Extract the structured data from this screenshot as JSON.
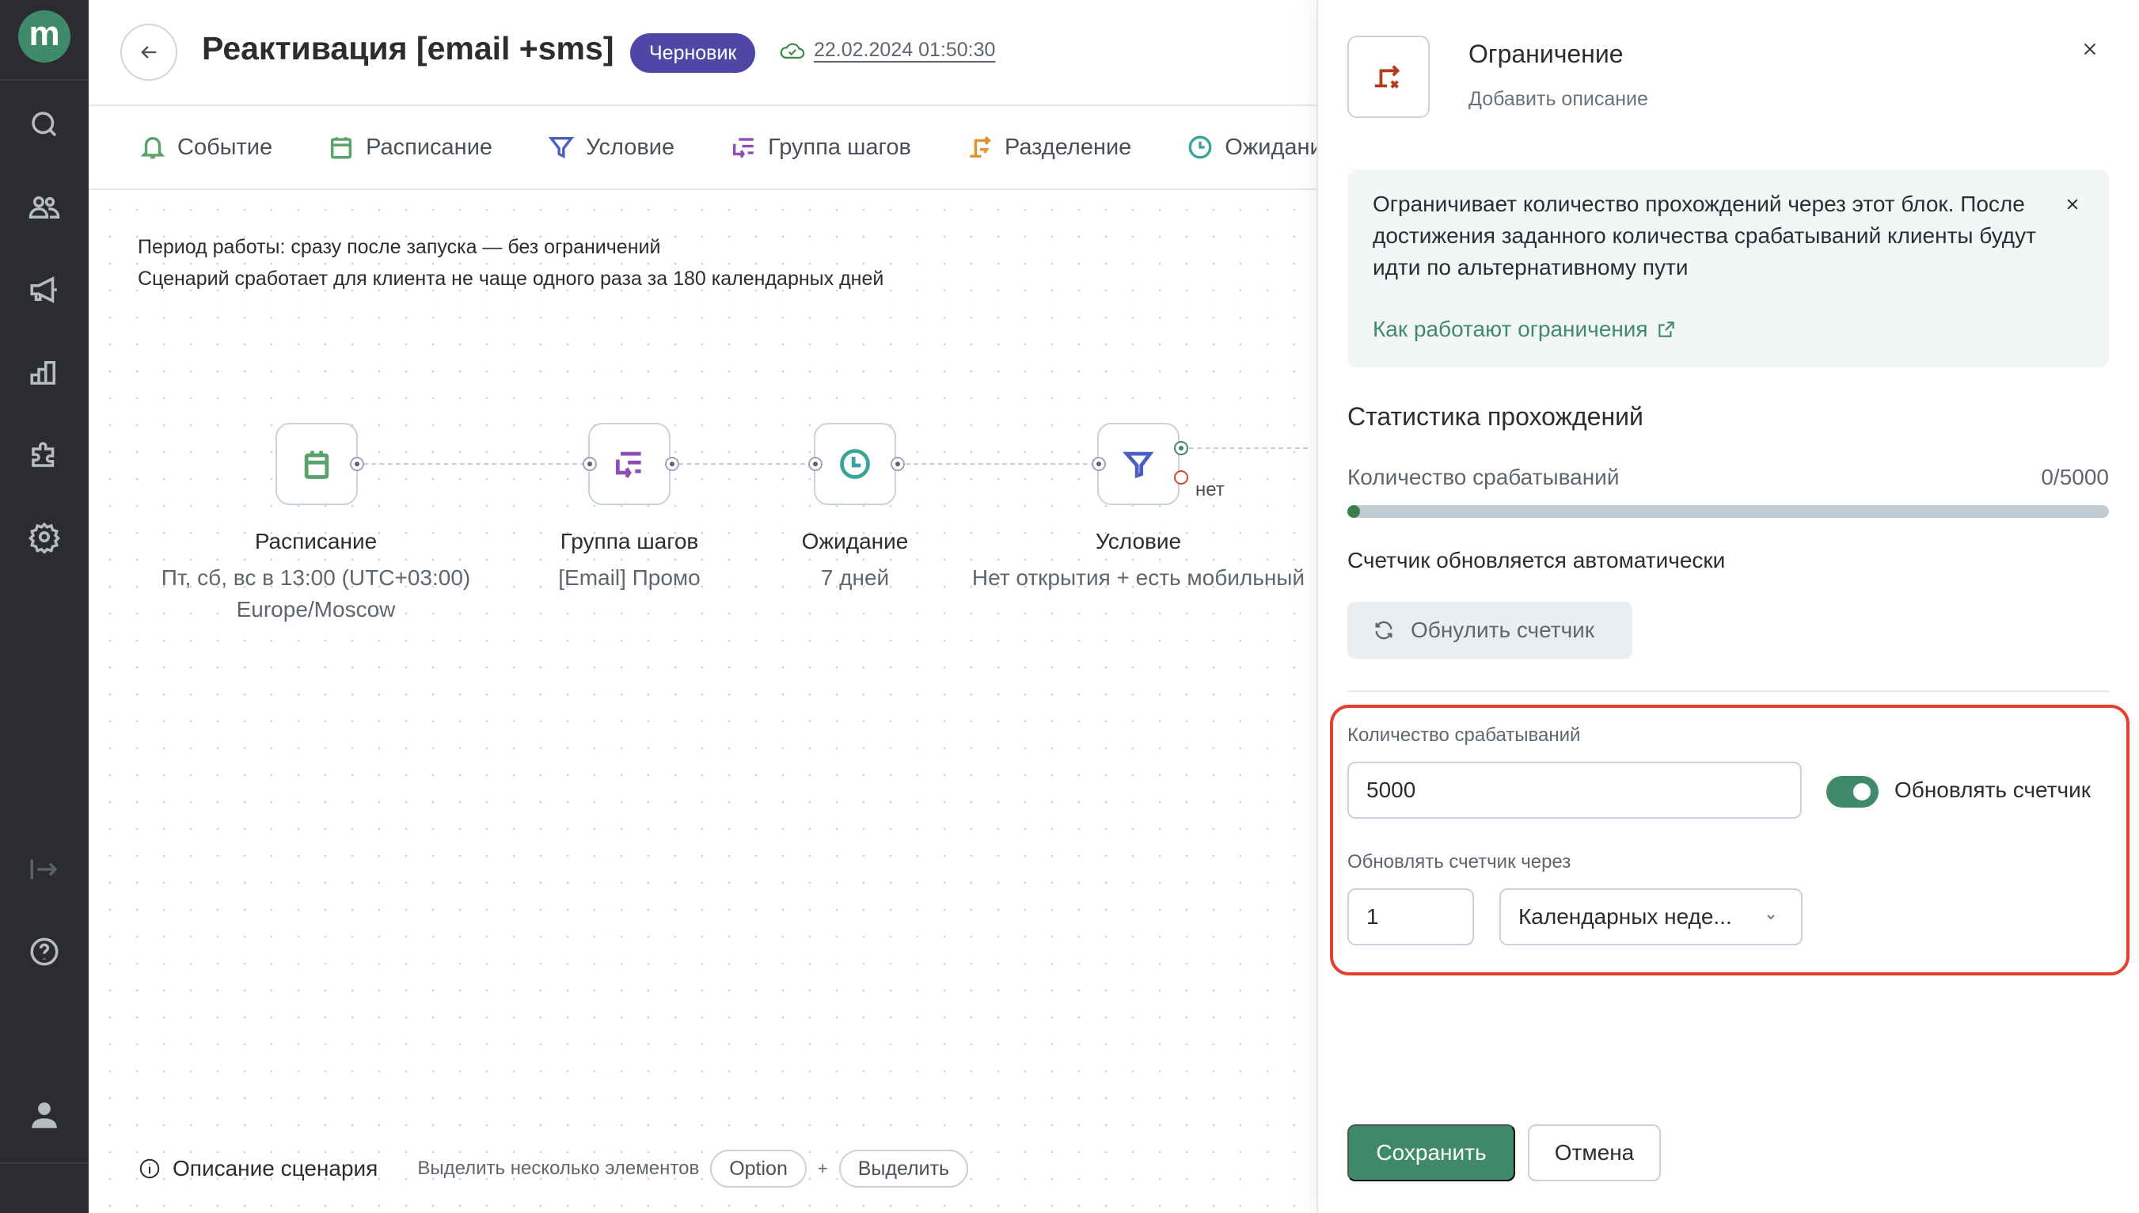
{
  "sidebar": {
    "logo_letter": "m",
    "items": [
      {
        "icon": "search-icon"
      },
      {
        "icon": "users-icon"
      },
      {
        "icon": "megaphone-icon"
      },
      {
        "icon": "analytics-icon"
      },
      {
        "icon": "puzzle-icon"
      },
      {
        "icon": "gear-icon"
      }
    ],
    "bottom_items": [
      {
        "icon": "expand-icon"
      },
      {
        "icon": "help-icon"
      },
      {
        "icon": "user-icon"
      }
    ]
  },
  "header": {
    "title": "Реактивация [email +sms]",
    "status_badge": "Черновик",
    "saved_at": "22.02.2024 01:50:30"
  },
  "toolbar": {
    "items": [
      {
        "label": "Событие",
        "icon": "bell-icon",
        "color": "#5aa26b"
      },
      {
        "label": "Расписание",
        "icon": "calendar-icon",
        "color": "#5aa26b"
      },
      {
        "label": "Условие",
        "icon": "filter-icon",
        "color": "#4a5fc1"
      },
      {
        "label": "Группа шагов",
        "icon": "step-group-icon",
        "color": "#8e4fb5"
      },
      {
        "label": "Разделение",
        "icon": "split-icon",
        "color": "#e09233"
      },
      {
        "label": "Ожидание",
        "icon": "clock-icon",
        "color": "#3aa39d"
      }
    ]
  },
  "canvas": {
    "info_lines": [
      "Период работы: сразу после запуска — без ограничений",
      "Сценарий сработает для клиента не чаще одного раза за 180 календарных дней"
    ],
    "nodes": [
      {
        "title": "Расписание",
        "subtitle": [
          "Пт, сб, вс в 13:00 (UTC+03:00)",
          "Europe/Moscow"
        ],
        "icon": "calendar-icon"
      },
      {
        "title": "Группа шагов",
        "subtitle": [
          "[Email] Промо"
        ],
        "icon": "step-group-icon"
      },
      {
        "title": "Ожидание",
        "subtitle": [
          "7 дней"
        ],
        "icon": "clock-icon"
      },
      {
        "title": "Условие",
        "subtitle": [
          "Нет открытия + есть мобильный"
        ],
        "icon": "filter-icon",
        "no_label": "нет"
      }
    ],
    "footer": {
      "description_label": "Описание сценария",
      "multi_select_hint": "Выделить несколько элементов",
      "key_option": "Option",
      "plus": "+",
      "key_select": "Выделить"
    }
  },
  "panel": {
    "title": "Ограничение",
    "description_placeholder": "Добавить описание",
    "hint": {
      "text": "Ограничивает количество прохождений через этот блок. После достижения заданного количества срабатываний клиенты будут идти по альтернативному пути",
      "link": "Как работают ограничения"
    },
    "stats": {
      "heading": "Статистика прохождений",
      "count_label": "Количество срабатываний",
      "count_value": "0/5000",
      "progress_fraction": 0,
      "auto_update_text": "Счетчик обновляется автоматически",
      "reset_button": "Обнулить счетчик"
    },
    "form": {
      "count_label": "Количество срабатываний",
      "count_value": "5000",
      "toggle_label": "Обновлять счетчик",
      "toggle_on": true,
      "period_label": "Обновлять счетчик через",
      "period_value": "1",
      "period_unit": "Календарных неде..."
    },
    "save_button": "Сохранить",
    "cancel_button": "Отмена"
  },
  "colors": {
    "accent": "#3f8a6b",
    "badge": "#4f46a5",
    "highlight": "#e2412c",
    "sidebar_bg": "#2a2c31"
  }
}
